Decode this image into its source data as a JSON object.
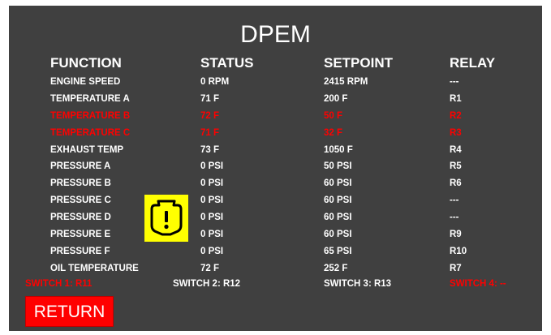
{
  "screen": {
    "title": "DPEM",
    "columns": {
      "function": "FUNCTION",
      "status": "STATUS",
      "setpoint": "SETPOINT",
      "relay": "RELAY"
    },
    "rows": [
      {
        "function": "ENGINE SPEED",
        "status": "0 RPM",
        "setpoint": "2415 RPM",
        "relay": "---",
        "alarm": false
      },
      {
        "function": "TEMPERATURE A",
        "status": "71 F",
        "setpoint": "200 F",
        "relay": "R1",
        "alarm": false
      },
      {
        "function": "TEMPERATURE B",
        "status": "72 F",
        "setpoint": "50 F",
        "relay": "R2",
        "alarm": true
      },
      {
        "function": "TEMPERATURE C",
        "status": "71 F",
        "setpoint": "32 F",
        "relay": "R3",
        "alarm": true
      },
      {
        "function": "EXHAUST TEMP",
        "status": "73 F",
        "setpoint": "1050 F",
        "relay": "R4",
        "alarm": false
      },
      {
        "function": "PRESSURE A",
        "status": "0 PSI",
        "setpoint": "50 PSI",
        "relay": "R5",
        "alarm": false
      },
      {
        "function": "PRESSURE B",
        "status": "0 PSI",
        "setpoint": "60 PSI",
        "relay": "R6",
        "alarm": false
      },
      {
        "function": "PRESSURE C",
        "status": "0 PSI",
        "setpoint": "60 PSI",
        "relay": "---",
        "alarm": false
      },
      {
        "function": "PRESSURE D",
        "status": "0 PSI",
        "setpoint": "60 PSI",
        "relay": "---",
        "alarm": false
      },
      {
        "function": "PRESSURE E",
        "status": "0 PSI",
        "setpoint": "60 PSI",
        "relay": "R9",
        "alarm": false
      },
      {
        "function": "PRESSURE F",
        "status": "0 PSI",
        "setpoint": "65 PSI",
        "relay": "R10",
        "alarm": false
      },
      {
        "function": "OIL TEMPERATURE",
        "status": "72 F",
        "setpoint": "252 F",
        "relay": "R7",
        "alarm": false
      }
    ],
    "switches": [
      {
        "label": "SWITCH 1:  R11",
        "alarm": true
      },
      {
        "label": "SWITCH 2:  R12",
        "alarm": false
      },
      {
        "label": "SWITCH 3:  R13",
        "alarm": false
      },
      {
        "label": "SWITCH 4:  --",
        "alarm": true
      }
    ],
    "warning_icon": "engine-warning-icon",
    "return_label": "RETURN",
    "colors": {
      "panel_bg": "#404040",
      "text": "#ffffff",
      "alarm": "#ff0000",
      "warning_bg": "#ffff00",
      "button_bg": "#ff0000"
    }
  }
}
